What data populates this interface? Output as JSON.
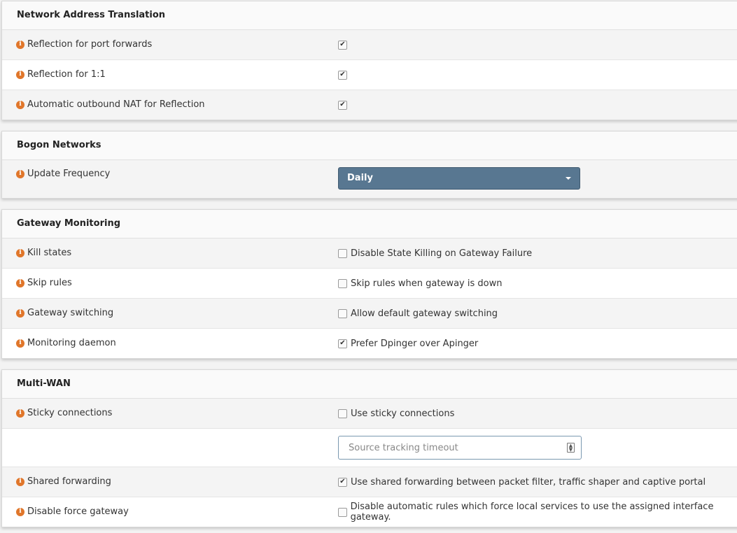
{
  "nat": {
    "title": "Network Address Translation",
    "rows": [
      {
        "label": "Reflection for port forwards",
        "checked": true
      },
      {
        "label": "Reflection for 1:1",
        "checked": true
      },
      {
        "label": "Automatic outbound NAT for Reflection",
        "checked": true
      }
    ]
  },
  "bogon": {
    "title": "Bogon Networks",
    "update_label": "Update Frequency",
    "update_value": "Daily"
  },
  "gateway": {
    "title": "Gateway Monitoring",
    "rows": [
      {
        "label": "Kill states",
        "option": "Disable State Killing on Gateway Failure",
        "checked": false
      },
      {
        "label": "Skip rules",
        "option": "Skip rules when gateway is down",
        "checked": false
      },
      {
        "label": "Gateway switching",
        "option": "Allow default gateway switching",
        "checked": false
      },
      {
        "label": "Monitoring daemon",
        "option": "Prefer Dpinger over Apinger",
        "checked": true
      }
    ]
  },
  "multiwan": {
    "title": "Multi-WAN",
    "sticky": {
      "label": "Sticky connections",
      "option": "Use sticky connections",
      "checked": false
    },
    "timeout_placeholder": "Source tracking timeout",
    "shared": {
      "label": "Shared forwarding",
      "option": "Use shared forwarding between packet filter, traffic shaper and captive portal",
      "checked": true
    },
    "force": {
      "label": "Disable force gateway",
      "option": "Disable automatic rules which force local services to use the assigned interface gateway.",
      "checked": false
    }
  },
  "icons": {
    "info": "info-circle-icon",
    "check": "checkmark-icon",
    "caret": "caret-down-icon",
    "spinner": "number-spinner-icon"
  },
  "colors": {
    "info": "#e0762a",
    "select_bg": "#587791",
    "panel_head_bg": "#fafafa",
    "row_shade": "#f4f4f4"
  }
}
